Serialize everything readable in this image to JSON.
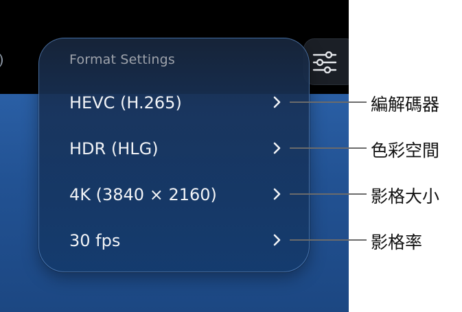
{
  "menu": {
    "header": "Format Settings",
    "items": [
      {
        "label": "HEVC (H.265)",
        "callout": "編解碼器"
      },
      {
        "label": "HDR (HLG)",
        "callout": "色彩空間"
      },
      {
        "label": "4K (3840 × 2160)",
        "callout": "影格大小"
      },
      {
        "label": "30 fps",
        "callout": "影格率"
      }
    ]
  },
  "colors": {
    "panel_background": "#17345f",
    "panel_border": "#6ea0e1",
    "screen_top": "#000000",
    "screen_background": "#1d4a84",
    "leader_line": "#6b6b6b"
  },
  "icons": {
    "settings_button": "sliders-icon",
    "row_arrow": "chevron-right-icon"
  }
}
